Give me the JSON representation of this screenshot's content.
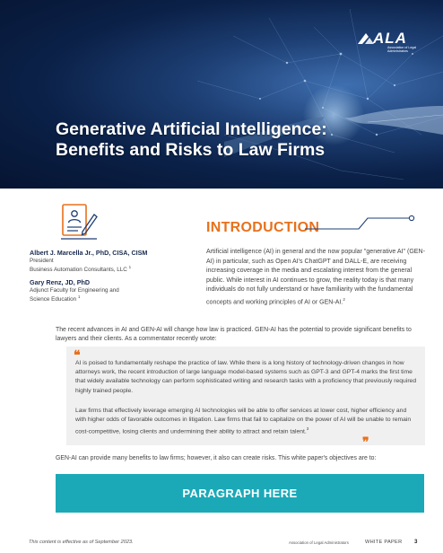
{
  "hero": {
    "title_line1": "Generative Artificial Intelligence:",
    "title_line2": "Benefits and Risks to Law Firms",
    "logo_text": "ALA",
    "logo_sub": "Association of Legal Administrators",
    "logo_icon": "ala-swoosh-icon"
  },
  "authors": [
    {
      "name": "Albert J. Marcella Jr., PhD, CISA, CISM",
      "role_line1": "President",
      "role_line2": "Business Automation Consultants, LLC",
      "footnote": "1"
    },
    {
      "name": "Gary Renz, JD, PhD",
      "role_line1": "Adjunct Faculty for Engineering and",
      "role_line2": "Science Education",
      "footnote": "1"
    }
  ],
  "document_icon": "document-pen-icon",
  "introduction": {
    "heading": "INTRODUCTION",
    "paragraph": "Artificial intelligence (AI) in general and the now popular \"generative AI\" (GEN-AI) in particular, such as Open AI's ChatGPT and DALL-E, are receiving increasing coverage in the media and escalating interest from the general public. While interest in AI continues to grow, the reality today is that many individuals do not fully understand or have familiarity with the fundamental concepts and working principles of AI or GEN-AI.",
    "paragraph_footnote": "2"
  },
  "lead_paragraph": "The recent advances in AI and GEN-AI will change how law is practiced. GEN-AI has the potential to provide significant benefits to lawyers and their clients. As a commentator recently wrote:",
  "quote": {
    "open_mark": "❝",
    "close_mark": "❞",
    "paragraph1": "AI is poised to fundamentally reshape the practice of law. While there is a long history of technology-driven changes in how attorneys work, the recent introduction of large language model-based systems such as GPT-3 and GPT-4 marks the first time that widely available technology can perform sophisticated writing and research tasks with a proficiency that previously required highly trained people.",
    "paragraph2": "Law firms that effectively leverage emerging AI technologies will be able to offer services at lower cost, higher efficiency and with higher odds of favorable outcomes in litigation. Law firms that fail to capitalize on the power of AI will be unable to remain cost-competitive, losing clients and undermining their ability to attract and retain talent.",
    "paragraph2_footnote": "3"
  },
  "closing_paragraph": "GEN-AI can provide many benefits to law firms; however, it also can create risks. This white paper's objectives are to:",
  "banner": {
    "label": "PARAGRAPH HERE",
    "color": "#1ba9b8"
  },
  "footer": {
    "left": "This content is effective as of September 2023.",
    "middle": "Association of Legal Administrators",
    "label": "WHITE PAPER",
    "page": "3"
  },
  "colors": {
    "accent_orange": "#e8711c",
    "hero_dark": "#0b2148",
    "teal": "#1ba9b8"
  }
}
